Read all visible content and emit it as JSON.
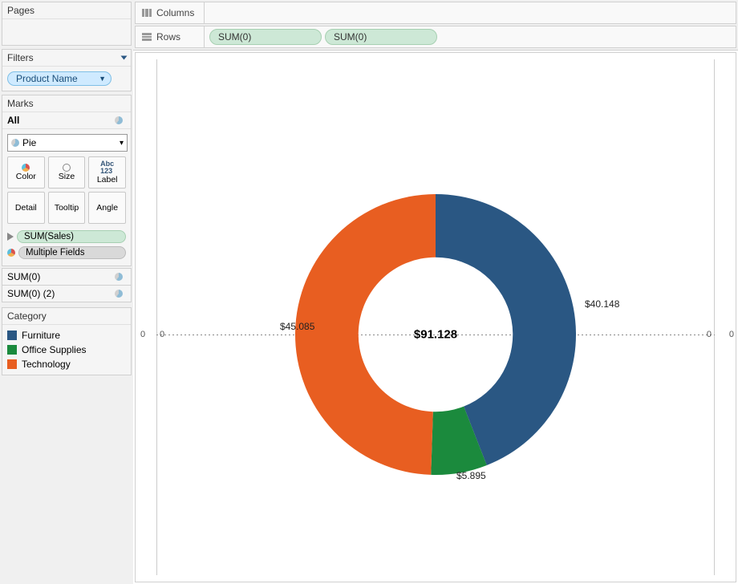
{
  "sidebar": {
    "pages_label": "Pages",
    "filters_label": "Filters",
    "filter_pill": "Product Name",
    "marks_label": "Marks",
    "marks_all": "All",
    "marks_type": "Pie",
    "cards": {
      "color": "Color",
      "size": "Size",
      "label": "Label",
      "detail": "Detail",
      "tooltip": "Tooltip",
      "angle": "Angle"
    },
    "pill_sumsales": "SUM(Sales)",
    "pill_multiple": "Multiple Fields",
    "sum0": "SUM(0)",
    "sum0_2": "SUM(0) (2)",
    "category_label": "Category",
    "legend": [
      {
        "name": "Furniture",
        "color": "#2a5783"
      },
      {
        "name": "Office Supplies",
        "color": "#1b8a3d"
      },
      {
        "name": "Technology",
        "color": "#e85e21"
      }
    ]
  },
  "shelves": {
    "columns_label": "Columns",
    "rows_label": "Rows",
    "row_pills": [
      "SUM(0)",
      "SUM(0)"
    ]
  },
  "viz": {
    "center_label": "$91.128",
    "axis_left": "0",
    "axis_right": "0",
    "tick_left": "0",
    "tick_right": "0",
    "slice_labels": {
      "furniture": "$40.148",
      "office": "$5.895",
      "technology": "$45.085"
    }
  },
  "chart_data": {
    "type": "pie",
    "title": "",
    "inner_label": "$91.128",
    "total": 91.128,
    "series": [
      {
        "name": "Furniture",
        "value": 40.148,
        "color": "#2a5783"
      },
      {
        "name": "Office Supplies",
        "value": 5.895,
        "color": "#1b8a3d"
      },
      {
        "name": "Technology",
        "value": 45.085,
        "color": "#e85e21"
      }
    ],
    "donut": true,
    "inner_radius_ratio": 0.55
  }
}
